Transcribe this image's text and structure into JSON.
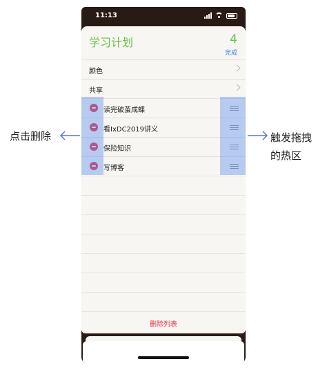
{
  "status_bar": {
    "time": "11:13"
  },
  "header": {
    "title": "学习计划",
    "count": "4",
    "done_label": "完成"
  },
  "settings_rows": [
    {
      "label": "颜色"
    },
    {
      "label": "共享"
    }
  ],
  "items": [
    {
      "label": "读完破茧成蝶"
    },
    {
      "label": "看IxDC2019讲义"
    },
    {
      "label": "保险知识"
    },
    {
      "label": "写博客"
    }
  ],
  "footer": {
    "delete_list_label": "删除列表"
  },
  "annotations": {
    "left": "点击删除",
    "right_line1": "触发拖拽",
    "right_line2": "的热区"
  },
  "colors": {
    "accent_green": "#6cc04a",
    "link_blue": "#2b7ed9",
    "delete_red": "#e8334a",
    "highlight_blue": "#5f8ceb"
  }
}
